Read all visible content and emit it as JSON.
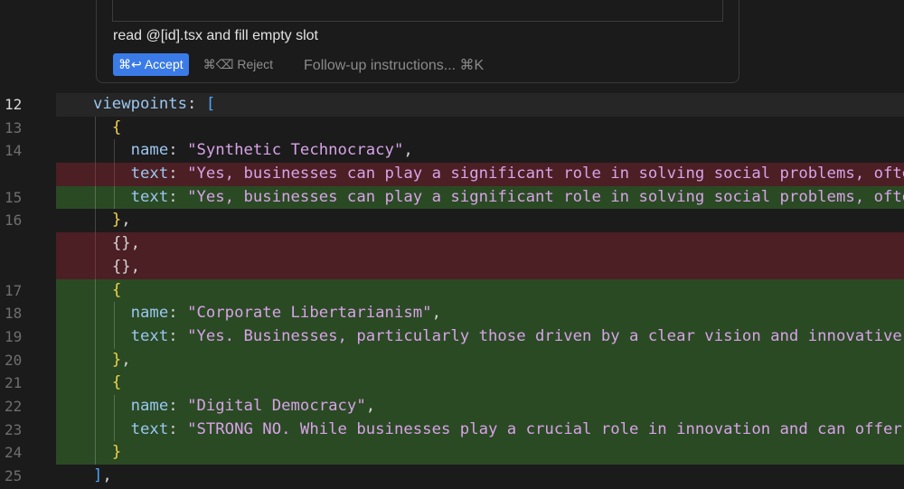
{
  "prompt": {
    "instruction": "read @[id].tsx and fill empty slot",
    "accept_label": "⌘↩ Accept",
    "reject_label": "⌘⌫ Reject",
    "followup_placeholder": "Follow-up instructions... ⌘K"
  },
  "editor": {
    "lines": [
      {
        "num": "12",
        "kind": "current",
        "indent": 0,
        "tokens": [
          [
            "k",
            "viewpoints"
          ],
          [
            "p",
            ": "
          ],
          [
            "b2",
            "["
          ]
        ]
      },
      {
        "num": "13",
        "kind": "normal",
        "indent": 1,
        "tokens": [
          [
            "b1",
            "{"
          ]
        ]
      },
      {
        "num": "14",
        "kind": "normal",
        "indent": 2,
        "tokens": [
          [
            "k",
            "name"
          ],
          [
            "p",
            ": "
          ],
          [
            "s",
            "\"Synthetic Technocracy\""
          ],
          [
            "p",
            ","
          ]
        ]
      },
      {
        "num": "",
        "kind": "del",
        "indent": 2,
        "tokens": [
          [
            "k",
            "text"
          ],
          [
            "p",
            ": "
          ],
          [
            "s",
            "\"Yes, businesses can play a significant role in solving social problems, often"
          ]
        ]
      },
      {
        "num": "15",
        "kind": "add",
        "indent": 2,
        "tokens": [
          [
            "k",
            "text"
          ],
          [
            "p",
            ": "
          ],
          [
            "s",
            "\"Yes, businesses can play a significant role in solving social problems, often"
          ]
        ]
      },
      {
        "num": "16",
        "kind": "normal",
        "indent": 1,
        "tokens": [
          [
            "b1",
            "}"
          ],
          [
            "p",
            ","
          ]
        ]
      },
      {
        "num": "",
        "kind": "del",
        "indent": 1,
        "tokens": [
          [
            "p",
            "{},"
          ]
        ]
      },
      {
        "num": "",
        "kind": "del",
        "indent": 1,
        "tokens": [
          [
            "p",
            "{},"
          ]
        ]
      },
      {
        "num": "17",
        "kind": "add",
        "indent": 1,
        "tokens": [
          [
            "b1",
            "{"
          ]
        ]
      },
      {
        "num": "18",
        "kind": "add",
        "indent": 2,
        "tokens": [
          [
            "k",
            "name"
          ],
          [
            "p",
            ": "
          ],
          [
            "s",
            "\"Corporate Libertarianism\""
          ],
          [
            "p",
            ","
          ]
        ]
      },
      {
        "num": "19",
        "kind": "add",
        "indent": 2,
        "tokens": [
          [
            "k",
            "text"
          ],
          [
            "p",
            ": "
          ],
          [
            "s",
            "\"Yes. Businesses, particularly those driven by a clear vision and innovative s"
          ]
        ]
      },
      {
        "num": "20",
        "kind": "add",
        "indent": 1,
        "tokens": [
          [
            "b1",
            "}"
          ],
          [
            "p",
            ","
          ]
        ]
      },
      {
        "num": "21",
        "kind": "add",
        "indent": 1,
        "tokens": [
          [
            "b1",
            "{"
          ]
        ]
      },
      {
        "num": "22",
        "kind": "add",
        "indent": 2,
        "tokens": [
          [
            "k",
            "name"
          ],
          [
            "p",
            ": "
          ],
          [
            "s",
            "\"Digital Democracy\""
          ],
          [
            "p",
            ","
          ]
        ]
      },
      {
        "num": "23",
        "kind": "add",
        "indent": 2,
        "tokens": [
          [
            "k",
            "text"
          ],
          [
            "p",
            ": "
          ],
          [
            "s",
            "\"STRONG NO. While businesses play a crucial role in innovation and can offer s"
          ]
        ]
      },
      {
        "num": "24",
        "kind": "add",
        "indent": 1,
        "tokens": [
          [
            "b1",
            "}"
          ]
        ]
      },
      {
        "num": "25",
        "kind": "normal",
        "indent": 0,
        "tokens": [
          [
            "b2",
            "]"
          ],
          [
            "p",
            ","
          ]
        ]
      }
    ]
  }
}
